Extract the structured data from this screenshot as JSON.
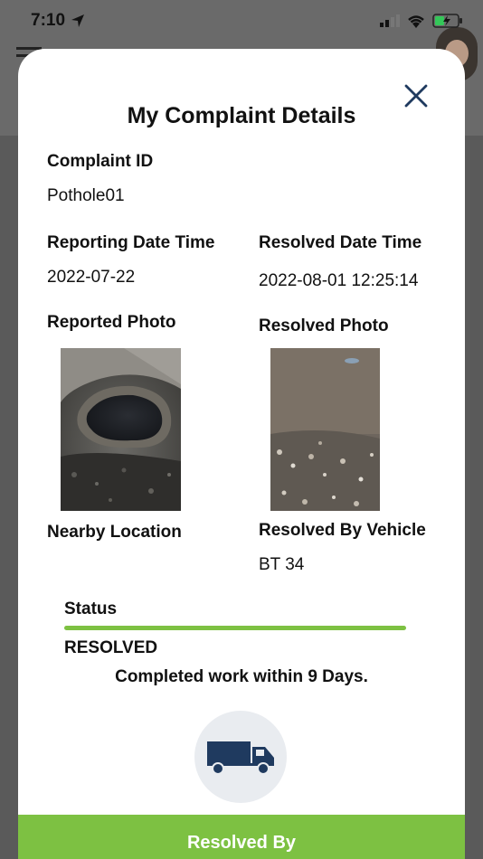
{
  "status_bar": {
    "time": "7:10"
  },
  "modal": {
    "title": "My Complaint Details",
    "complaint_id_label": "Complaint ID",
    "complaint_id_value": "Pothole01",
    "reporting_label": "Reporting Date Time",
    "reporting_value": "2022-07-22",
    "resolved_date_label": "Resolved Date Time",
    "resolved_date_value": "2022-08-01 12:25:14",
    "reported_photo_label": "Reported Photo",
    "resolved_photo_label": "Resolved Photo",
    "nearby_location_label": "Nearby Location",
    "resolved_vehicle_label": "Resolved By Vehicle",
    "resolved_vehicle_value": "BT 34",
    "status_label": "Status",
    "status_value": "RESOLVED",
    "completion_note": "Completed work within 9 Days.",
    "resolved_by_button": "Resolved By"
  },
  "colors": {
    "accent_green": "#7dc142",
    "icon_navy": "#1f3a5f",
    "overlay": "#5a5a5a"
  },
  "icons": [
    "navigation-arrow-icon",
    "signal-icon",
    "wifi-icon",
    "battery-icon",
    "close-icon",
    "truck-icon",
    "menu-icon"
  ]
}
